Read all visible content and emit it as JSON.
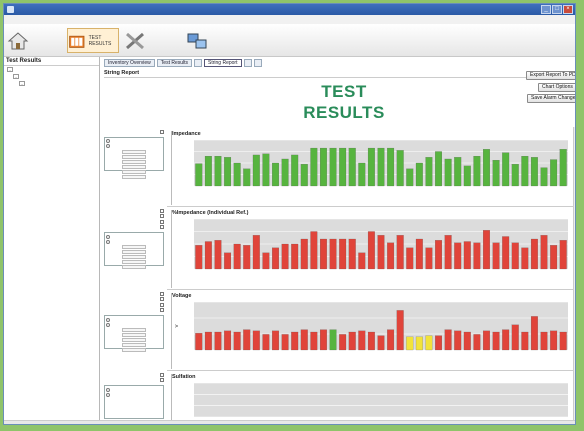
{
  "window": {
    "title": "",
    "controls": [
      "_",
      "□",
      "×"
    ]
  },
  "menu": {
    "items": [
      "",
      "",
      "",
      ""
    ]
  },
  "toolbar": {
    "buttons": [
      {
        "label": "",
        "icon": "home-icon"
      },
      {
        "label": "TEST RESULTS",
        "icon": "folder-icon",
        "active": true
      },
      {
        "label": "",
        "icon": "wrench-icon"
      },
      {
        "label": "",
        "icon": "network-icon"
      }
    ]
  },
  "left_panel": {
    "header": "Test Results",
    "tree": [
      {
        "label": "",
        "depth": 0,
        "expander": "-"
      },
      {
        "label": "",
        "depth": 1,
        "expander": "-"
      },
      {
        "label": "",
        "depth": 2,
        "expander": "-"
      },
      {
        "label": "",
        "depth": 3,
        "expander": ""
      },
      {
        "label": "",
        "depth": 3,
        "expander": "",
        "selected": true
      },
      {
        "label": "",
        "depth": 3,
        "expander": ""
      },
      {
        "label": "",
        "depth": 3,
        "expander": ""
      }
    ]
  },
  "tabs": [
    {
      "label": "Inventory Overview",
      "active": false
    },
    {
      "label": "Test Results",
      "active": false
    },
    {
      "label": "",
      "active": false
    },
    {
      "label": "String Report",
      "active": true
    },
    {
      "label": "",
      "active": false
    },
    {
      "label": "",
      "active": false
    }
  ],
  "report": {
    "header": "String Report",
    "fields": [
      {
        "key": "",
        "value": ""
      },
      {
        "key": "",
        "value": ""
      },
      {
        "key": "",
        "value": ""
      },
      {
        "key": "",
        "value": ""
      },
      {
        "key": "",
        "value": ""
      }
    ],
    "buttons": {
      "export": "Export Report To PDF",
      "chart_options": "Chart Options",
      "save_alarms": "Save Alarm Changes"
    }
  },
  "overlay_title": "TEST\nRESULTS",
  "controls": {
    "impedance": {
      "checks": [
        ""
      ],
      "group_title": "",
      "options": [
        "",
        ""
      ],
      "fields": 6
    },
    "pct_impedance": {
      "checks": [
        "",
        "",
        "",
        ""
      ],
      "group_title": "",
      "options": [
        "",
        ""
      ],
      "fields": 5
    },
    "voltage": {
      "checks": [
        "",
        "",
        "",
        ""
      ],
      "group_title": "",
      "options": [
        "",
        ""
      ],
      "fields": 5
    },
    "sulfation": {
      "checks": [
        "",
        ""
      ],
      "group_title": "",
      "options": [
        "",
        ""
      ]
    }
  },
  "colors": {
    "green": "#57b43f",
    "red": "#e0443a",
    "yellow": "#f2e33a",
    "title_green": "#2a8c5a",
    "plot_bg": "#dcdcdc"
  },
  "chart_data": [
    {
      "type": "bar",
      "title": "Impedance",
      "ylabel": "",
      "ylim": [
        0.0,
        0.08
      ],
      "yticks": [
        "",
        "",
        "",
        "",
        ""
      ],
      "values": [
        0.039,
        0.052,
        0.052,
        0.05,
        0.04,
        0.03,
        0.054,
        0.056,
        0.04,
        0.047,
        0.054,
        0.038,
        0.066,
        0.066,
        0.066,
        0.066,
        0.066,
        0.04,
        0.066,
        0.066,
        0.066,
        0.062,
        0.03,
        0.04,
        0.05,
        0.06,
        0.047,
        0.05,
        0.035,
        0.052,
        0.064,
        0.045,
        0.058,
        0.038,
        0.052,
        0.05,
        0.032,
        0.046,
        0.064
      ],
      "colors": [
        "g",
        "g",
        "g",
        "g",
        "g",
        "g",
        "g",
        "g",
        "g",
        "g",
        "g",
        "g",
        "g",
        "g",
        "g",
        "g",
        "g",
        "g",
        "g",
        "g",
        "g",
        "g",
        "g",
        "g",
        "g",
        "g",
        "g",
        "g",
        "g",
        "g",
        "g",
        "g",
        "g",
        "g",
        "g",
        "g",
        "g",
        "g",
        "g"
      ]
    },
    {
      "type": "bar",
      "title": "%Impedance (Individual Ref.)",
      "ylabel": "",
      "ylim": [
        0,
        40
      ],
      "yticks": [
        "",
        "",
        "",
        "",
        ""
      ],
      "values": [
        19,
        22,
        23,
        13,
        20,
        19,
        27,
        13,
        17,
        20,
        20,
        24,
        30,
        24,
        24,
        24,
        24,
        13,
        30,
        27,
        21,
        27,
        17,
        24,
        17,
        23,
        27,
        21,
        22,
        21,
        31,
        21,
        26,
        21,
        17,
        24,
        27,
        19,
        23
      ],
      "colors": [
        "r",
        "r",
        "r",
        "r",
        "r",
        "r",
        "r",
        "r",
        "r",
        "r",
        "r",
        "r",
        "r",
        "r",
        "r",
        "r",
        "r",
        "r",
        "r",
        "r",
        "r",
        "r",
        "r",
        "r",
        "r",
        "r",
        "r",
        "r",
        "r",
        "r",
        "r",
        "r",
        "r",
        "r",
        "r",
        "r",
        "r",
        "r",
        "r"
      ]
    },
    {
      "type": "bar",
      "title": "Voltage",
      "ylabel": "V",
      "ylim": [
        2.05,
        2.45
      ],
      "yticks": [
        "",
        "",
        "",
        ""
      ],
      "values": [
        2.19,
        2.2,
        2.2,
        2.21,
        2.2,
        2.22,
        2.21,
        2.18,
        2.21,
        2.18,
        2.2,
        2.22,
        2.2,
        2.22,
        2.22,
        2.18,
        2.2,
        2.21,
        2.2,
        2.17,
        2.22,
        2.38,
        2.16,
        2.16,
        2.17,
        2.17,
        2.22,
        2.21,
        2.2,
        2.18,
        2.21,
        2.2,
        2.22,
        2.26,
        2.2,
        2.33,
        2.2,
        2.21,
        2.2
      ],
      "colors": [
        "r",
        "r",
        "r",
        "r",
        "r",
        "r",
        "r",
        "r",
        "r",
        "r",
        "r",
        "r",
        "r",
        "r",
        "g",
        "r",
        "r",
        "r",
        "r",
        "r",
        "r",
        "r",
        "y",
        "y",
        "y",
        "r",
        "r",
        "r",
        "r",
        "r",
        "r",
        "r",
        "r",
        "r",
        "r",
        "r",
        "r",
        "r",
        "r"
      ]
    },
    {
      "type": "bar",
      "title": "Sulfation",
      "ylabel": "",
      "ylim": [
        0,
        100
      ],
      "yticks": [
        "",
        "",
        "",
        ""
      ],
      "values": []
    }
  ]
}
